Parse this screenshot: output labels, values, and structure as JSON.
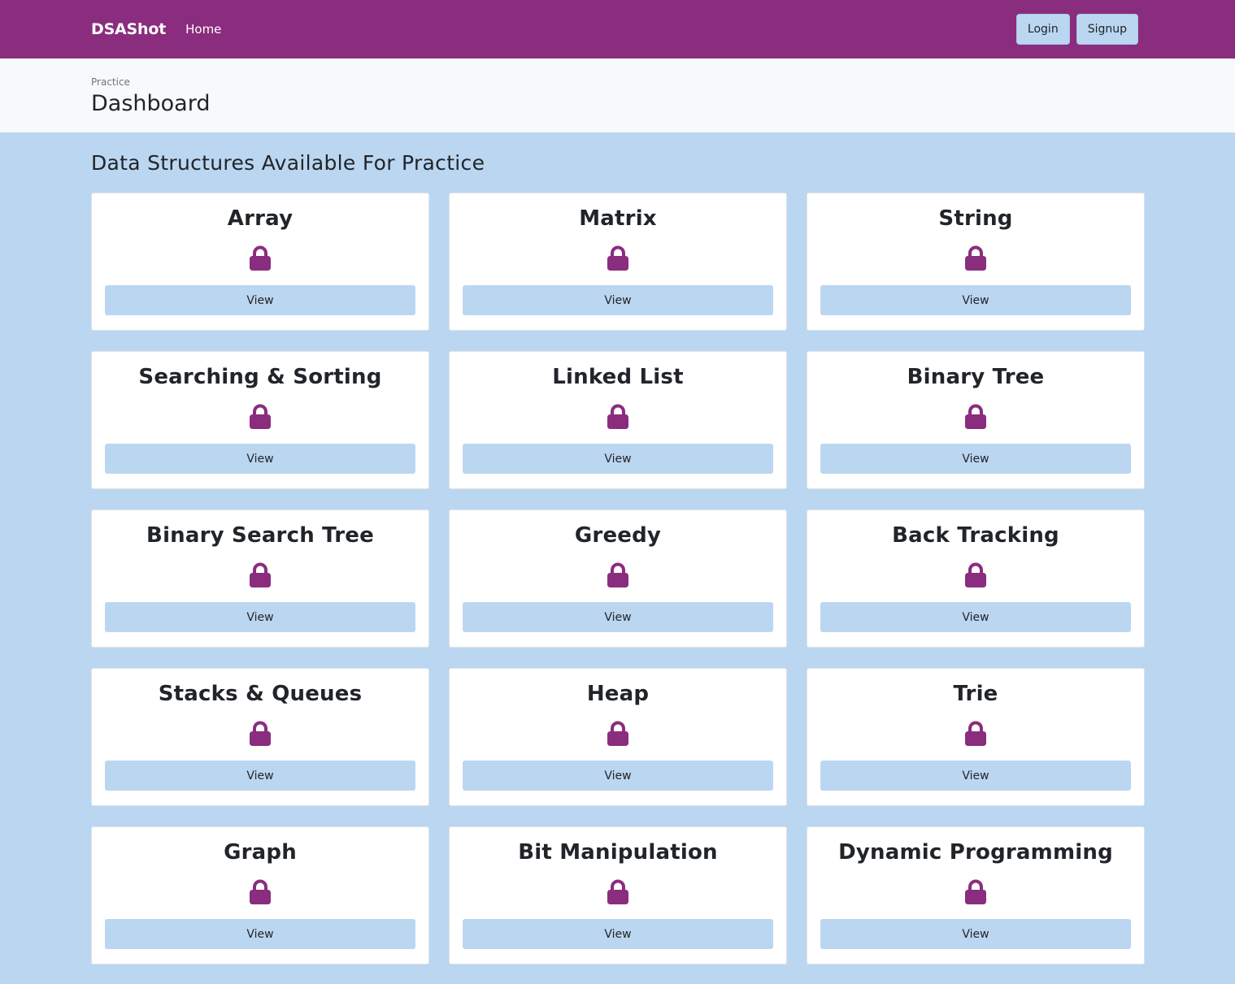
{
  "navbar": {
    "brand": "DSAShot",
    "home_label": "Home",
    "login_label": "Login",
    "signup_label": "Signup"
  },
  "header": {
    "breadcrumb": "Practice",
    "title": "Dashboard"
  },
  "main": {
    "section_title": "Data Structures Available For Practice",
    "cards": [
      {
        "title": "Array",
        "button": "View",
        "icon": "lock-icon"
      },
      {
        "title": "Matrix",
        "button": "View",
        "icon": "lock-icon"
      },
      {
        "title": "String",
        "button": "View",
        "icon": "lock-icon"
      },
      {
        "title": "Searching & Sorting",
        "button": "View",
        "icon": "lock-icon"
      },
      {
        "title": "Linked List",
        "button": "View",
        "icon": "lock-icon"
      },
      {
        "title": "Binary Tree",
        "button": "View",
        "icon": "lock-icon"
      },
      {
        "title": "Binary Search Tree",
        "button": "View",
        "icon": "lock-icon"
      },
      {
        "title": "Greedy",
        "button": "View",
        "icon": "lock-icon"
      },
      {
        "title": "Back Tracking",
        "button": "View",
        "icon": "lock-icon"
      },
      {
        "title": "Stacks & Queues",
        "button": "View",
        "icon": "lock-icon"
      },
      {
        "title": "Heap",
        "button": "View",
        "icon": "lock-icon"
      },
      {
        "title": "Trie",
        "button": "View",
        "icon": "lock-icon"
      },
      {
        "title": "Graph",
        "button": "View",
        "icon": "lock-icon"
      },
      {
        "title": "Bit Manipulation",
        "button": "View",
        "icon": "lock-icon"
      },
      {
        "title": "Dynamic Programming",
        "button": "View",
        "icon": "lock-icon"
      }
    ]
  },
  "colors": {
    "brand_purple": "#8a2d7e",
    "accent_blue": "#bbd6f1",
    "header_bg": "#f8f9fa",
    "card_bg": "#ffffff"
  }
}
